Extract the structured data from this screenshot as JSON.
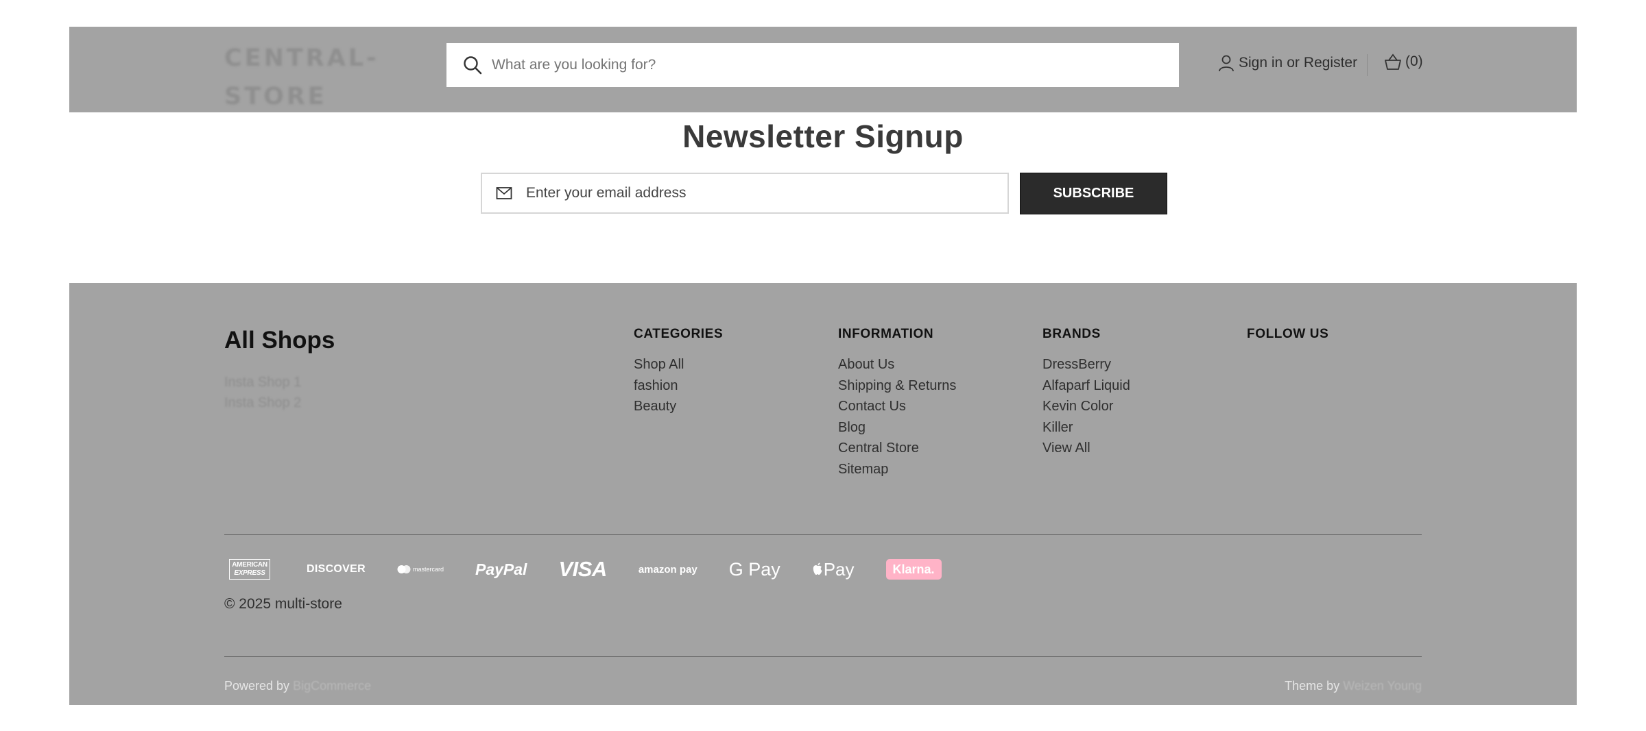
{
  "header": {
    "logo_line1": "CENTRAL-",
    "logo_line2": "STORE",
    "search_placeholder": "What are you looking for?",
    "sign_in": "Sign in",
    "or": "or",
    "register": "Register",
    "cart_count": "(0)"
  },
  "newsletter": {
    "title": "Newsletter Signup",
    "email_placeholder": "Enter your email address",
    "subscribe_label": "SUBSCRIBE"
  },
  "footer": {
    "shops_title": "All Shops",
    "shops": [
      "Insta Shop 1",
      "Insta Shop 2"
    ],
    "categories": {
      "heading": "CATEGORIES",
      "items": [
        "Shop All",
        "fashion",
        "Beauty"
      ]
    },
    "information": {
      "heading": "INFORMATION",
      "items": [
        "About Us",
        "Shipping & Returns",
        "Contact Us",
        "Blog",
        "Central Store",
        "Sitemap"
      ]
    },
    "brands": {
      "heading": "BRANDS",
      "items": [
        "DressBerry",
        "Alfaparf Liquid",
        "Kevin Color",
        "Killer",
        "View All"
      ]
    },
    "follow": {
      "heading": "FOLLOW US"
    },
    "payments": {
      "amex_line1": "AMERICAN",
      "amex_line2": "EXPRESS",
      "discover": "DISCOVER",
      "mastercard": "mastercard",
      "paypal": "PayPal",
      "visa": "VISA",
      "amazonpay": "amazon pay",
      "gpay": "G Pay",
      "applepay": "Pay",
      "klarna": "Klarna."
    },
    "copyright": "© 2025 multi-store",
    "powered_by": "Powered by",
    "powered_link": "BigCommerce",
    "theme_by": "Theme by",
    "theme_link": "Weizen Young"
  },
  "colors": {
    "band_gray": "#a3a3a3",
    "button_dark": "#2b2b2b",
    "klarna_pink": "#ffb3c7"
  }
}
